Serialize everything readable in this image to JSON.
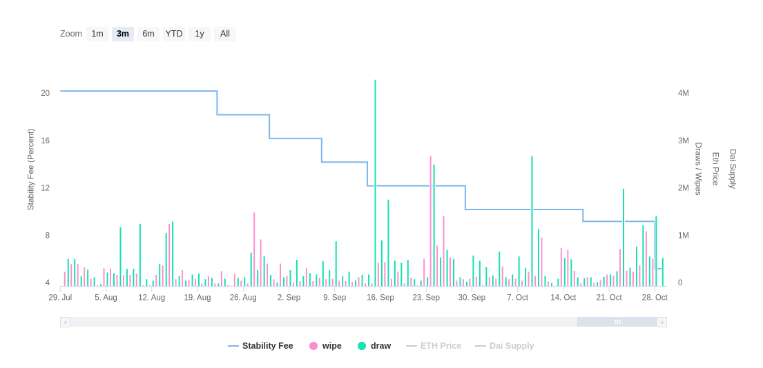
{
  "range_selector": {
    "label": "Zoom",
    "buttons": [
      {
        "label": "1m",
        "selected": false
      },
      {
        "label": "3m",
        "selected": true
      },
      {
        "label": "6m",
        "selected": false
      },
      {
        "label": "YTD",
        "selected": false
      },
      {
        "label": "1y",
        "selected": false
      },
      {
        "label": "All",
        "selected": false
      }
    ]
  },
  "legend": [
    {
      "label": "Stability Fee",
      "symbol": "line",
      "color": "#7cb5ec",
      "active": true
    },
    {
      "label": "wipe",
      "symbol": "circle",
      "color": "#fc8fd2",
      "active": true
    },
    {
      "label": "draw",
      "symbol": "circle",
      "color": "#12e2b0",
      "active": true
    },
    {
      "label": "ETH Price",
      "symbol": "line",
      "color": "#cccccc",
      "active": false
    },
    {
      "label": "Dai Supply",
      "symbol": "line",
      "color": "#cccccc",
      "active": false
    }
  ],
  "scrollbar": {
    "range_start_pct": 86.4,
    "range_end_pct": 100
  },
  "chart_data": {
    "type": "bar",
    "title": "",
    "xlabel": "",
    "xlim": [
      "29 Jul",
      "29 Oct"
    ],
    "x_ticks": [
      "29. Jul",
      "5. Aug",
      "12. Aug",
      "19. Aug",
      "26. Aug",
      "2. Sep",
      "9. Sep",
      "16. Sep",
      "23. Sep",
      "30. Sep",
      "7. Oct",
      "14. Oct",
      "21. Oct",
      "28. Oct"
    ],
    "y_left": {
      "title": "Stability Fee (Percent)",
      "min": 4,
      "max": 24,
      "ticks": [
        4,
        8,
        12,
        16,
        20
      ],
      "tick_labels": [
        "4",
        "8",
        "12",
        "16",
        "20"
      ]
    },
    "y_right": {
      "titles": [
        "Draws / Wipes",
        "Eth Price",
        "Dai Supply"
      ],
      "unit": "millions",
      "min": 0,
      "max": 5,
      "ticks": [
        0,
        1,
        2,
        3,
        4
      ],
      "tick_labels": [
        "0",
        "1M",
        "2M",
        "3M",
        "4M"
      ]
    },
    "grid": false,
    "legend_position": "bottom-center",
    "categories": [
      "30 Jul",
      "31 Jul",
      "1 Aug",
      "2 Aug",
      "3 Aug",
      "4 Aug",
      "5 Aug",
      "6 Aug",
      "7 Aug",
      "8 Aug",
      "9 Aug",
      "10 Aug",
      "11 Aug",
      "12 Aug",
      "13 Aug",
      "14 Aug",
      "15 Aug",
      "16 Aug",
      "17 Aug",
      "18 Aug",
      "19 Aug",
      "20 Aug",
      "21 Aug",
      "22 Aug",
      "23 Aug",
      "24 Aug",
      "25 Aug",
      "26 Aug",
      "27 Aug",
      "28 Aug",
      "29 Aug",
      "30 Aug",
      "31 Aug",
      "1 Sep",
      "2 Sep",
      "3 Sep",
      "4 Sep",
      "5 Sep",
      "6 Sep",
      "7 Sep",
      "8 Sep",
      "9 Sep",
      "10 Sep",
      "11 Sep",
      "12 Sep",
      "13 Sep",
      "14 Sep",
      "15 Sep",
      "16 Sep",
      "17 Sep",
      "18 Sep",
      "19 Sep",
      "20 Sep",
      "21 Sep",
      "22 Sep",
      "23 Sep",
      "24 Sep",
      "25 Sep",
      "26 Sep",
      "27 Sep",
      "28 Sep",
      "29 Sep",
      "30 Sep",
      "1 Oct",
      "2 Oct",
      "3 Oct",
      "4 Oct",
      "5 Oct",
      "6 Oct",
      "7 Oct",
      "8 Oct",
      "9 Oct",
      "10 Oct",
      "11 Oct",
      "12 Oct",
      "13 Oct",
      "14 Oct",
      "15 Oct",
      "16 Oct",
      "17 Oct",
      "18 Oct",
      "19 Oct",
      "20 Oct",
      "21 Oct",
      "22 Oct",
      "23 Oct",
      "24 Oct",
      "25 Oct",
      "26 Oct",
      "27 Oct",
      "28 Oct",
      "29 Oct"
    ],
    "series": [
      {
        "name": "Stability Fee",
        "type": "step-line",
        "axis": "left",
        "color": "#7cb5ec",
        "points": [
          {
            "x": "29 Jul",
            "y": 20.5
          },
          {
            "x": "22 Aug",
            "y": 18.5
          },
          {
            "x": "30 Aug",
            "y": 16.5
          },
          {
            "x": "7 Sep",
            "y": 14.5
          },
          {
            "x": "14 Sep",
            "y": 12.5
          },
          {
            "x": "29 Sep",
            "y": 10.5
          },
          {
            "x": "17 Oct",
            "y": 9.5
          },
          {
            "x": "28 Oct",
            "y": 5.5
          },
          {
            "x": "29 Oct",
            "y": 5.5
          }
        ]
      },
      {
        "name": "wipe",
        "type": "column",
        "axis": "right",
        "color": "#fc8fd2",
        "values": [
          0.32,
          0.48,
          0.48,
          0.41,
          0.17,
          0.03,
          0.39,
          0.38,
          0.25,
          0.25,
          0.25,
          0.28,
          0.03,
          0.04,
          0.25,
          0.45,
          1.33,
          0.16,
          0.35,
          0.14,
          0.17,
          0.07,
          0.22,
          0.07,
          0.33,
          0.04,
          0.28,
          0.13,
          0.07,
          1.57,
          1.0,
          0.49,
          0.16,
          0.49,
          0.23,
          0.09,
          0.12,
          0.39,
          0.12,
          0.19,
          0.16,
          0.17,
          0.13,
          0.12,
          0.1,
          0.2,
          0.07,
          0.07,
          0.51,
          0.52,
          0.17,
          0.32,
          0.07,
          0.19,
          0.03,
          0.59,
          2.76,
          0.87,
          1.49,
          0.62,
          0.13,
          0.16,
          0.17,
          0.21,
          0.04,
          0.2,
          0.17,
          0.43,
          0.16,
          0.17,
          0.13,
          0.32,
          0.23,
          1.04,
          0.11,
          0.02,
          0.82,
          0.78,
          0.34,
          0.07,
          0.2,
          0.08,
          0.14,
          0.26,
          0.23,
          0.8,
          0.34,
          0.32,
          0.45,
          1.17,
          0.59,
          0.02
        ]
      },
      {
        "name": "draw",
        "type": "column",
        "axis": "right",
        "color": "#12e2b0",
        "values": [
          0.59,
          0.59,
          0.23,
          0.36,
          0.2,
          0.06,
          0.3,
          0.29,
          1.26,
          0.38,
          0.38,
          1.33,
          0.16,
          0.13,
          0.48,
          1.14,
          1.38,
          0.23,
          0.13,
          0.26,
          0.28,
          0.16,
          0.19,
          0.07,
          0.17,
          0,
          0.19,
          0.2,
          0.72,
          0.35,
          0.65,
          0.25,
          0.09,
          0.2,
          0.35,
          0.57,
          0.23,
          0.29,
          0.26,
          0.54,
          0.35,
          0.96,
          0.23,
          0.32,
          0.13,
          0.25,
          0.26,
          4.37,
          0.98,
          1.84,
          0.55,
          0.51,
          0.57,
          0.16,
          0.13,
          0.2,
          2.58,
          0.62,
          0.78,
          0.59,
          0.2,
          0.11,
          0.66,
          0.55,
          0.42,
          0.24,
          0.74,
          0.2,
          0.26,
          0.64,
          0.4,
          2.76,
          1.22,
          0.23,
          0.08,
          0.17,
          0.61,
          0.58,
          0.2,
          0.18,
          0.2,
          0.1,
          0.21,
          0.26,
          0.33,
          2.07,
          0.4,
          0.85,
          1.3,
          0.64,
          1.49,
          0.61
        ]
      },
      {
        "name": "ETH Price",
        "type": "line",
        "axis": "right",
        "visible": false
      },
      {
        "name": "Dai Supply",
        "type": "line",
        "axis": "right",
        "visible": false
      }
    ]
  }
}
